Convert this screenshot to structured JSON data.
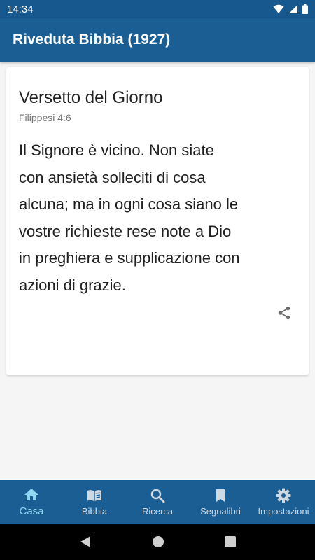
{
  "status": {
    "time": "14:34"
  },
  "app_bar": {
    "title": "Riveduta Bibbia (1927)"
  },
  "verse_card": {
    "title": "Versetto del Giorno",
    "reference": "Filippesi 4:6",
    "lines": [
      "Il Signore è vicino. Non siate",
      "con ansietà solleciti di cosa",
      "alcuna; ma in ogni cosa siano le",
      "vostre richieste rese note a Dio",
      "in preghiera e supplicazione con",
      "azioni di grazie."
    ]
  },
  "bottom_nav": {
    "items": [
      {
        "label": "Casa",
        "icon": "home-icon",
        "active": true
      },
      {
        "label": "Bibbia",
        "icon": "book-icon"
      },
      {
        "label": "Ricerca",
        "icon": "search-icon"
      },
      {
        "label": "Segnalibri",
        "icon": "bookmark-icon"
      },
      {
        "label": "Impostazioni",
        "icon": "gear-icon"
      }
    ]
  },
  "colors": {
    "primary": "#1b5e93",
    "accent": "#8fd6f2"
  }
}
